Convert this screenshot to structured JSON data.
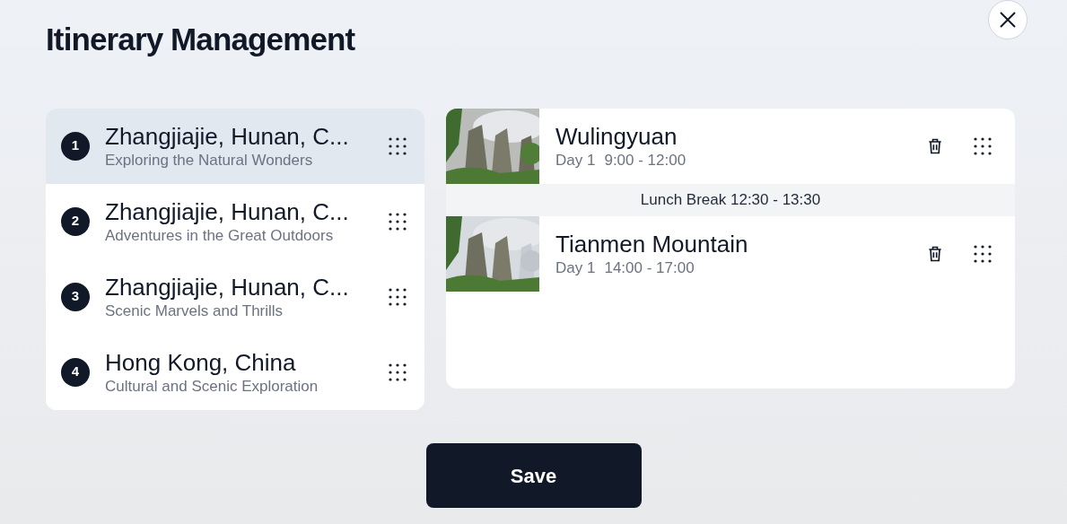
{
  "title": "Itinerary Management",
  "destinations": [
    {
      "number": "1",
      "name": "Zhangjiajie, Hunan, C...",
      "subtitle": "Exploring the Natural Wonders",
      "selected": true
    },
    {
      "number": "2",
      "name": "Zhangjiajie, Hunan, C...",
      "subtitle": "Adventures in the Great Outdoors",
      "selected": false
    },
    {
      "number": "3",
      "name": "Zhangjiajie, Hunan, C...",
      "subtitle": "Scenic Marvels and Thrills",
      "selected": false
    },
    {
      "number": "4",
      "name": "Hong Kong, China",
      "subtitle": "Cultural and Scenic Exploration",
      "selected": false
    }
  ],
  "schedule": [
    {
      "kind": "attraction",
      "name": "Wulingyuan",
      "day": "Day 1",
      "time": "9:00 - 12:00"
    },
    {
      "kind": "break",
      "text": "Lunch Break 12:30 - 13:30"
    },
    {
      "kind": "attraction",
      "name": "Tianmen Mountain",
      "day": "Day 1",
      "time": "14:00 - 17:00"
    }
  ],
  "save_button": "Save"
}
